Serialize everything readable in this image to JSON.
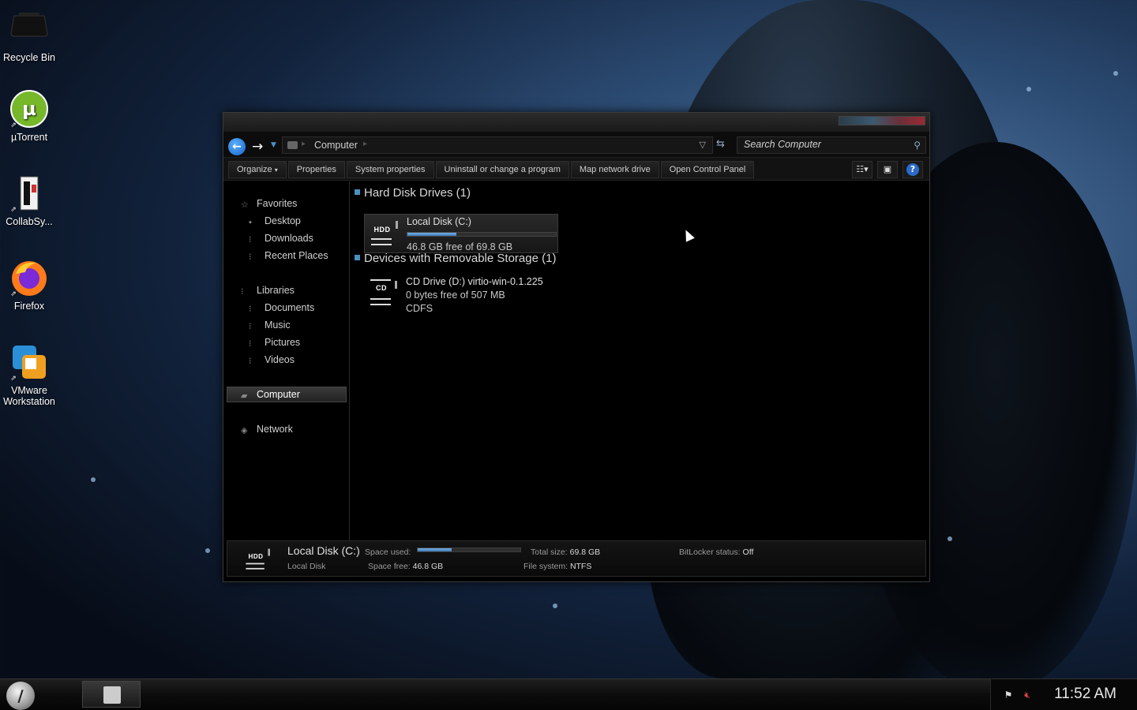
{
  "desktop": {
    "icons": [
      {
        "label": "Recycle Bin",
        "icon": "recycle-bin-icon"
      },
      {
        "label": "µTorrent",
        "icon": "utorrent-icon"
      },
      {
        "label": "CollabSy...",
        "icon": "collabsync-icon"
      },
      {
        "label": "Firefox",
        "icon": "firefox-icon"
      },
      {
        "label": "VMware Workstation",
        "icon": "vmware-icon"
      }
    ]
  },
  "window": {
    "address": {
      "crumb": "Computer"
    },
    "search": {
      "placeholder": "Search Computer"
    },
    "toolbar": {
      "organize": "Organize",
      "properties": "Properties",
      "system_properties": "System properties",
      "uninstall": "Uninstall or change a program",
      "map_drive": "Map network drive",
      "control_panel": "Open Control Panel"
    },
    "nav": {
      "favorites": "Favorites",
      "desktop": "Desktop",
      "downloads": "Downloads",
      "recent": "Recent Places",
      "libraries": "Libraries",
      "documents": "Documents",
      "music": "Music",
      "pictures": "Pictures",
      "videos": "Videos",
      "computer": "Computer",
      "network": "Network"
    },
    "groups": {
      "hdd_title": "Hard Disk Drives (1)",
      "removable_title": "Devices with Removable Storage (1)"
    },
    "drives": {
      "c": {
        "name": "Local Disk (C:)",
        "free": "46.8 GB free of 69.8 GB",
        "used_fraction": 0.33,
        "icon_label": "HDD"
      },
      "d": {
        "name": "CD Drive (D:) virtio-win-0.1.225",
        "free": "0 bytes free of 507 MB",
        "fs": "CDFS",
        "icon_label": "CD"
      }
    },
    "details": {
      "title": "Local Disk (C:)",
      "subtitle": "Local Disk",
      "space_used_label": "Space used:",
      "space_free_label": "Space free:",
      "space_free": "46.8 GB",
      "total_label": "Total size:",
      "total": "69.8 GB",
      "fs_label": "File system:",
      "fs": "NTFS",
      "bitlocker_label": "BitLocker status:",
      "bitlocker": "Off",
      "icon_label": "HDD"
    }
  },
  "taskbar": {
    "clock": "11:52 AM"
  },
  "colors": {
    "accent": "#1464c8",
    "usage_fill": "#3a78b8",
    "window_bg": "#000000"
  }
}
